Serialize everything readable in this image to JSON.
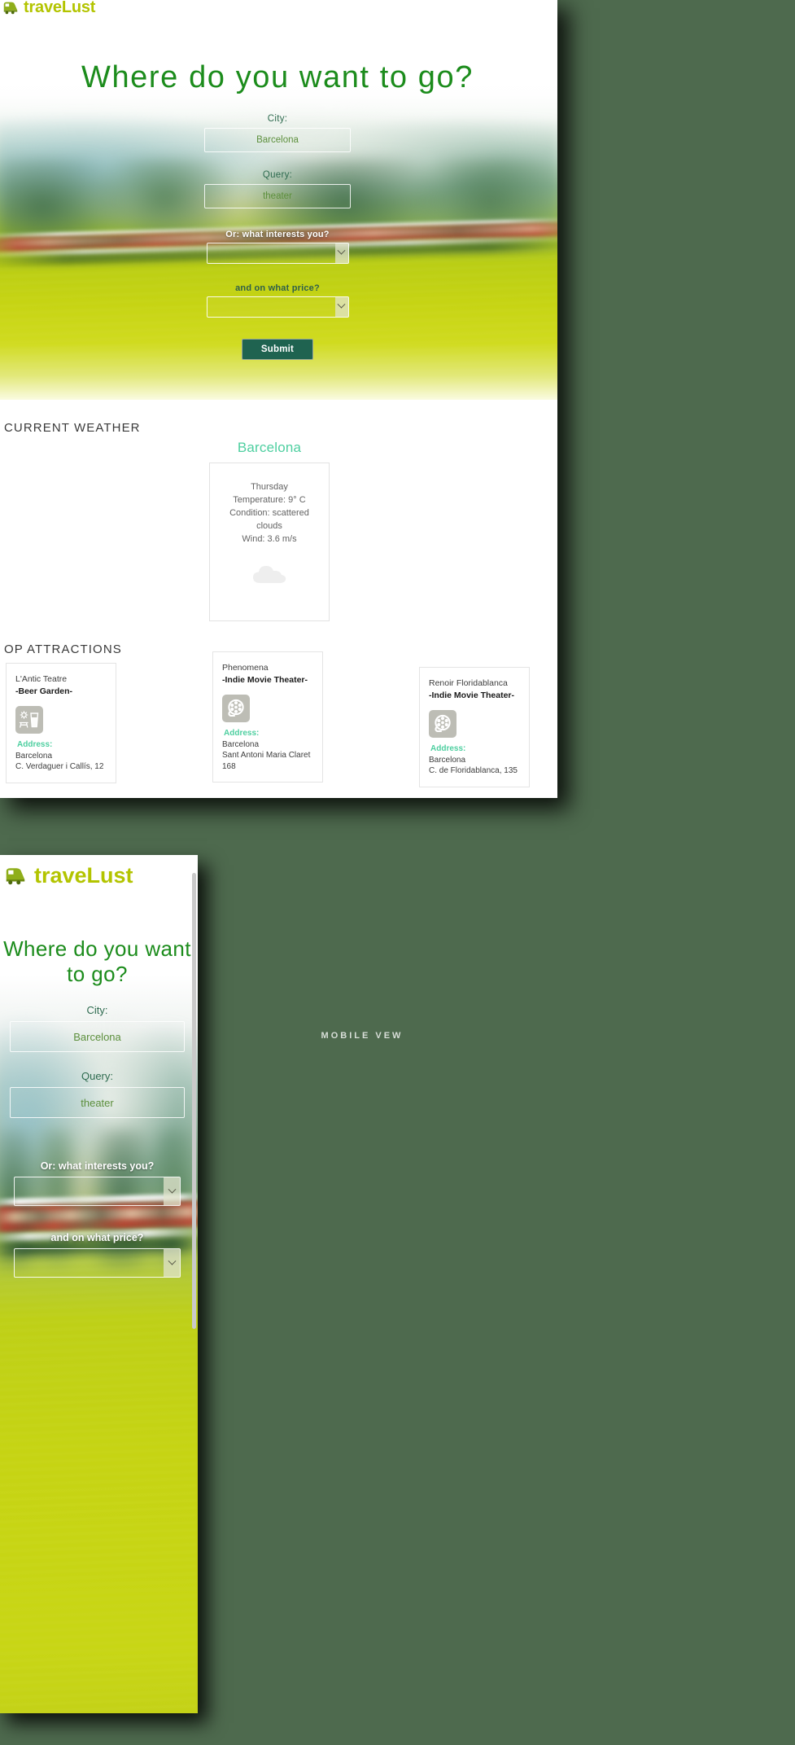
{
  "brand": {
    "name": "traveLust",
    "logo_icon": "train-icon",
    "color": "#b3c400"
  },
  "desktop": {
    "hero": {
      "title": "Where do you want to go?",
      "fields": [
        {
          "label": "City:",
          "value": "Barcelona",
          "placeholder": "Barcelona",
          "name": "city"
        },
        {
          "label": "Query:",
          "value": "theater",
          "placeholder": "theater",
          "name": "query"
        }
      ],
      "selects": [
        {
          "label": "Or: what interests you?",
          "selected": "",
          "options": []
        },
        {
          "label": "and on what price?",
          "selected": "",
          "options": []
        }
      ],
      "submit_label": "Submit"
    },
    "weather": {
      "heading": "CURRENT WEATHER",
      "city": "Barcelona",
      "day": "Thursday",
      "temperature": "Temperature: 9° C",
      "condition": "Condition: scattered clouds",
      "wind": "Wind: 3.6 m/s",
      "icon": "cloud-icon"
    },
    "attractions": {
      "heading": "OP ATTRACTIONS",
      "address_label": "Address:",
      "cards": [
        {
          "name": "L'Antic Teatre",
          "type": "-Beer Garden-",
          "icon": "beer-garden-icon",
          "city": "Barcelona",
          "street": "C. Verdaguer i Callís, 12"
        },
        {
          "name": "Phenomena",
          "type": "-Indie Movie Theater-",
          "icon": "film-reel-icon",
          "city": "Barcelona",
          "street": "Sant Antoni Maria Claret 168"
        },
        {
          "name": "Renoir Floridablanca",
          "type": "-Indie Movie Theater-",
          "icon": "film-reel-icon",
          "city": "Barcelona",
          "street": "C. de Floridablanca, 135"
        }
      ]
    }
  },
  "mobile": {
    "caption": "MOBILE VEW",
    "hero": {
      "title": "Where do you want to go?",
      "fields": [
        {
          "label": "City:",
          "value": "Barcelona",
          "placeholder": "Barcelona"
        },
        {
          "label": "Query:",
          "value": "theater",
          "placeholder": "theater"
        }
      ],
      "selects": [
        {
          "label": "Or: what interests you?",
          "selected": ""
        },
        {
          "label": "and on what price?",
          "selected": ""
        }
      ]
    }
  },
  "colors": {
    "canvas": "#4e6a4e",
    "brand_olive": "#b3c400",
    "title_green": "#1c8c1c",
    "accent_mint": "#4ecfa0",
    "submit_bg": "#1f6350"
  }
}
